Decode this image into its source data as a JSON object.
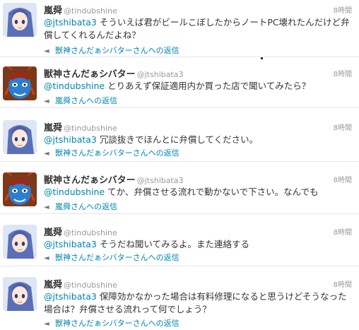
{
  "tweets": [
    {
      "name": "嵐舜",
      "handle": "@tindubshine",
      "time": "8時間",
      "mention": "@jtshibata3",
      "body": " そういえば君がビールこぼしたからノートPC壊れたんだけど弁償してくれるんだよね？",
      "reply": "獣神さんだぁシバターさんへの返信",
      "avatar": "anime-girl-avatar"
    },
    {
      "name": "獣神さんだぁシバター",
      "handle": "@jtshibata3",
      "time": "8時間",
      "mention": "@tindubshine",
      "body": " とりあえず保証適用内か買った店で聞いてみたら？",
      "reply": "嵐舜さんへの返信",
      "avatar": "blue-mask-avatar"
    },
    {
      "name": "嵐舜",
      "handle": "@tindubshine",
      "time": "8時間",
      "mention": "@jtshibata3",
      "body": " 冗談抜きでほんとに弁償してください。",
      "reply": "獣神さんだぁシバターさんへの返信",
      "avatar": "anime-girl-avatar"
    },
    {
      "name": "獣神さんだぁシバター",
      "handle": "@jtshibata3",
      "time": "8時間",
      "mention": "@tindubshine",
      "body": " てか、弁償させる流れで動かないで下さい。なんでも",
      "reply": "嵐舜さんへの返信",
      "avatar": "blue-mask-avatar"
    },
    {
      "name": "嵐舜",
      "handle": "@tindubshine",
      "time": "8時間",
      "mention": "@jtshibata3",
      "body": " そうだね聞いてみるよ。また連絡する",
      "reply": "獣神さんだぁシバターさんへの返信",
      "avatar": "anime-girl-avatar"
    },
    {
      "name": "嵐舜",
      "handle": "@tindubshine",
      "time": "8時間",
      "mention": "@jtshibata3",
      "body": " 保障効かなかった場合は有料修理になると思うけどそうなった場合は？弁償させる流れって何でしょう？",
      "reply": "獣神さんだぁシバターさんへの返信",
      "avatar": "anime-girl-avatar"
    }
  ],
  "colors": {
    "link": "#0084b4",
    "text": "#333333",
    "meta": "#999999"
  }
}
